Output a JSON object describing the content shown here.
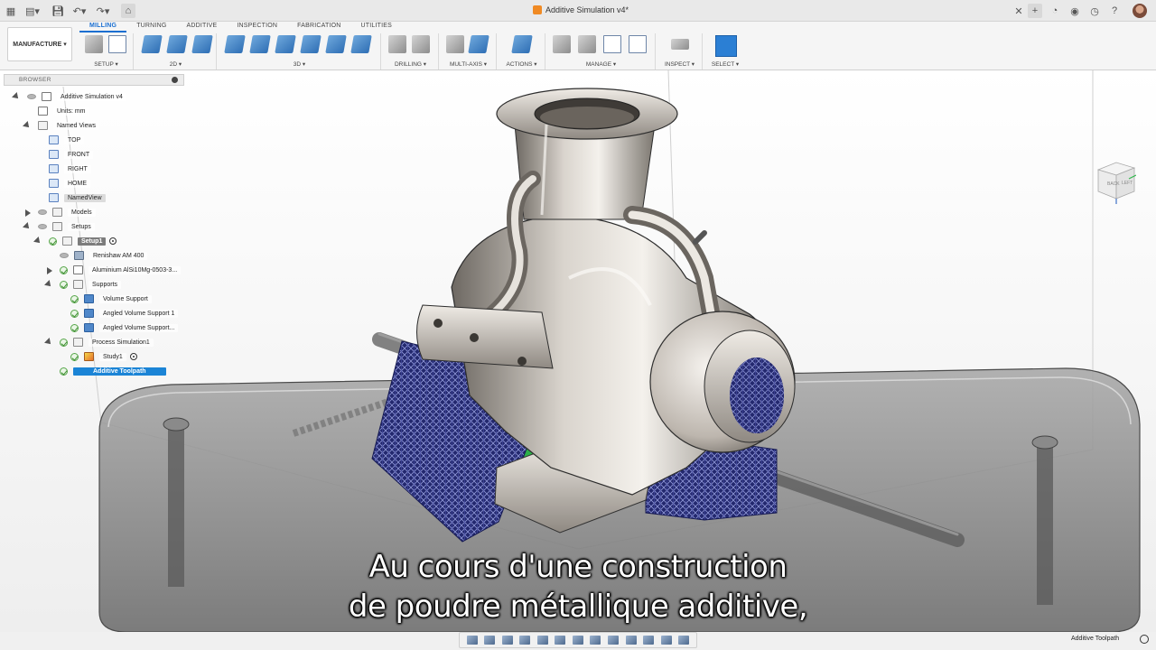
{
  "window": {
    "title": "Additive Simulation v4*"
  },
  "ribbon": {
    "workspace": "MANUFACTURE ▾",
    "tabs": [
      {
        "label": "MILLING",
        "active": true
      },
      {
        "label": "TURNING",
        "active": false
      },
      {
        "label": "ADDITIVE",
        "active": false
      },
      {
        "label": "INSPECTION",
        "active": false
      },
      {
        "label": "FABRICATION",
        "active": false
      },
      {
        "label": "UTILITIES",
        "active": false
      }
    ],
    "groups": {
      "setup": "SETUP ▾",
      "twod": "2D ▾",
      "threed": "3D ▾",
      "drilling": "DRILLING ▾",
      "multiaxis": "MULTI-AXIS ▾",
      "actions": "ACTIONS ▾",
      "manage": "MANAGE ▾",
      "inspect": "INSPECT ▾",
      "select": "SELECT ▾"
    }
  },
  "browser": {
    "header": "BROWSER",
    "items": {
      "root": "Additive Simulation v4",
      "units": "Units: mm",
      "named_views": "Named Views",
      "top": "TOP",
      "front": "FRONT",
      "right": "RIGHT",
      "home": "HOME",
      "named_view": "NamedView",
      "models": "Models",
      "setups": "Setups",
      "setup1": "Setup1",
      "machine": "Renishaw AM 400",
      "material": "Aluminium AlSi10Mg-0503-3...",
      "supports": "Supports",
      "volume_support": "Volume Support",
      "angled_support_1": "Angled Volume Support 1",
      "angled_support_2": "Angled Volume Support...",
      "process_sim": "Process Simulation1",
      "study1": "Study1",
      "additive_toolpath": "Additive Toolpath"
    }
  },
  "viewcube": {
    "back": "BACK",
    "left": "LEFT"
  },
  "subtitles": {
    "line1": "Au cours d'une construction",
    "line2": "de poudre métallique additive,"
  },
  "status": {
    "text": "Additive Toolpath"
  },
  "colors": {
    "accent": "#1a6fd1",
    "selection": "#1b84d6",
    "support_mesh": "#2a2f7a",
    "build_plate": "#2db04a"
  }
}
